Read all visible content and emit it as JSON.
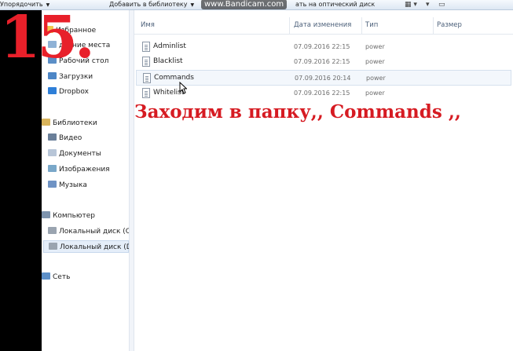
{
  "toolbar": {
    "organize": "Упорядочить",
    "add_to_library": "Добавить в библиотеку",
    "watermark": "www.Bandicam.com",
    "burn": "ать на оптический диск"
  },
  "overlay": {
    "step_number": "15.",
    "caption": "Заходим в папку,, Commands ,,"
  },
  "sidebar": {
    "favorites": [
      {
        "label": "Избранное",
        "icon": "star-icon"
      },
      {
        "label": "давние места",
        "icon": "recent-places-icon"
      },
      {
        "label": "Рабочий стол",
        "icon": "desktop-icon"
      },
      {
        "label": "Загрузки",
        "icon": "downloads-icon"
      },
      {
        "label": "Dropbox",
        "icon": "dropbox-icon"
      }
    ],
    "libraries": [
      {
        "label": "Библиотеки",
        "icon": "libraries-icon"
      },
      {
        "label": "Видео",
        "icon": "video-icon"
      },
      {
        "label": "Документы",
        "icon": "documents-icon"
      },
      {
        "label": "Изображения",
        "icon": "pictures-icon"
      },
      {
        "label": "Музыка",
        "icon": "music-icon"
      }
    ],
    "computer": [
      {
        "label": "Компьютер",
        "icon": "computer-icon"
      },
      {
        "label": "Локальный диск (C:)",
        "icon": "drive-icon"
      },
      {
        "label": "Локальный диск (D:)",
        "icon": "drive-icon",
        "selected": true
      }
    ],
    "network": [
      {
        "label": "Сеть",
        "icon": "network-icon"
      }
    ]
  },
  "columns": {
    "name": "Имя",
    "date": "Дата изменения",
    "type": "Тип",
    "size": "Размер"
  },
  "files": [
    {
      "name": "Adminlist",
      "date": "07.09.2016 22:15",
      "type": "power"
    },
    {
      "name": "Blacklist",
      "date": "07.09.2016 22:15",
      "type": "power"
    },
    {
      "name": "Commands",
      "date": "07.09.2016 20:14",
      "type": "power",
      "selected": true
    },
    {
      "name": "Whitelist",
      "date": "07.09.2016 22:15",
      "type": "power"
    }
  ],
  "colors": {
    "overlay_red": "#e8202a",
    "selection": "#e5eef9"
  }
}
